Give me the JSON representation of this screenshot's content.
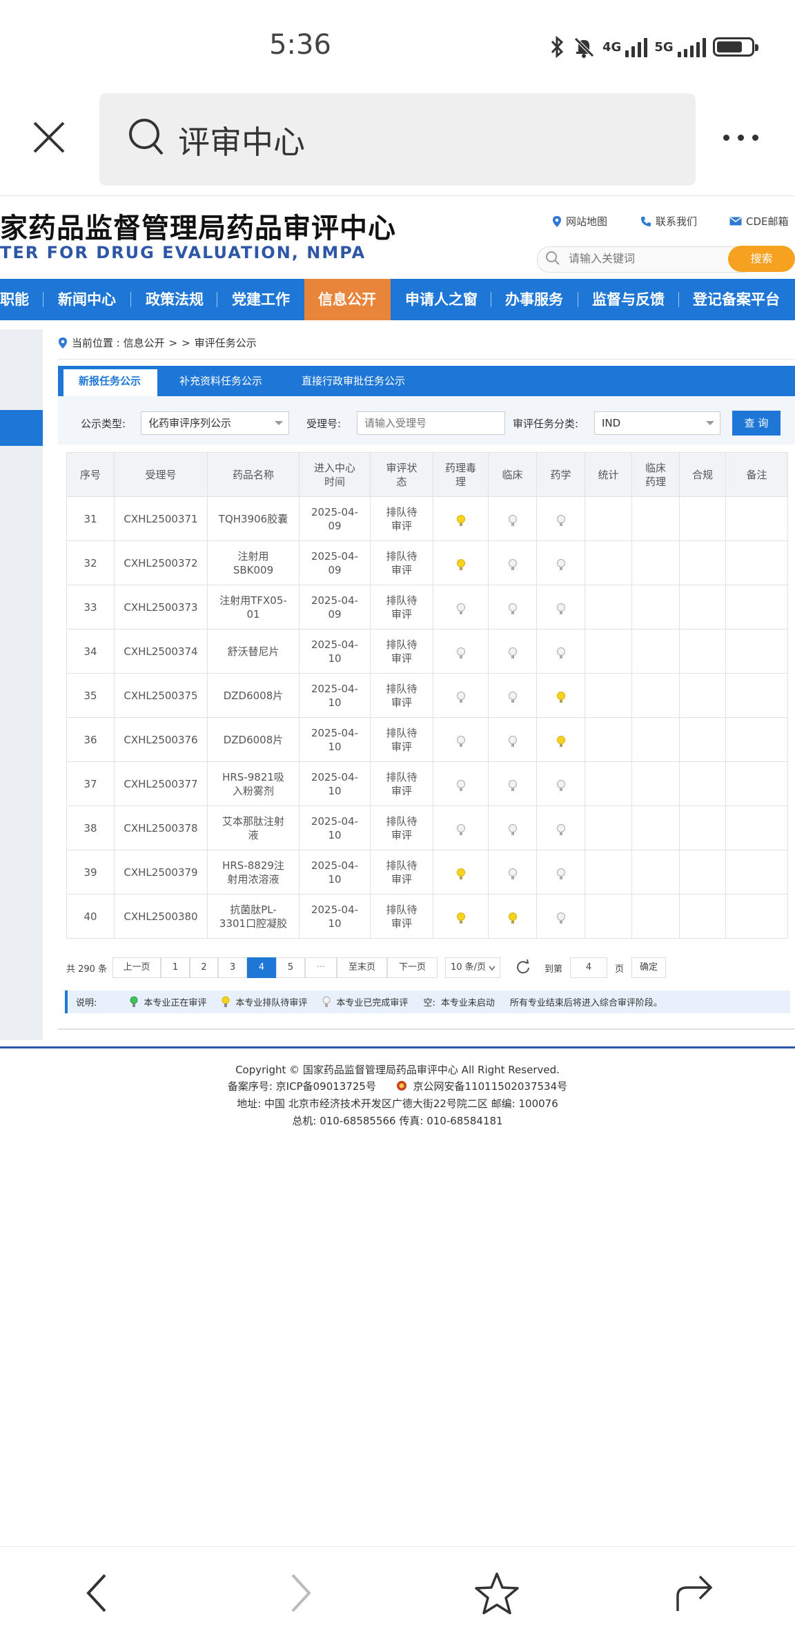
{
  "status_bar": {
    "time": "5:36",
    "net1": "4G",
    "net2": "5G"
  },
  "browser": {
    "search_text": "评审中心"
  },
  "site": {
    "title": "家药品监督管理局药品审评中心",
    "subtitle": "TER FOR DRUG EVALUATION, NMPA",
    "top_links": [
      "网站地图",
      "联系我们",
      "CDE邮箱"
    ],
    "search_placeholder": "请输入关键词",
    "search_button": "搜索"
  },
  "nav": {
    "items": [
      "职能",
      "新闻中心",
      "政策法规",
      "党建工作",
      "信息公开",
      "申请人之窗",
      "办事服务",
      "监督与反馈",
      "登记备案平台"
    ],
    "active": "信息公开"
  },
  "breadcrumb": {
    "label": "当前位置 : 信息公开",
    "sep1": ">",
    "sep2": ">",
    "current": "审评任务公示"
  },
  "tabs": [
    "新报任务公示",
    "补充资料任务公示",
    "直接行政审批任务公示"
  ],
  "filters": {
    "type_label": "公示类型:",
    "type_value": "化药审评序列公示",
    "accept_label": "受理号:",
    "accept_placeholder": "请输入受理号",
    "class_label": "审评任务分类:",
    "class_value": "IND",
    "query_button": "查 询"
  },
  "table": {
    "headers": [
      "序号",
      "受理号",
      "药品名称",
      "进入中心\n时间",
      "审评状\n态",
      "药理毒\n理",
      "临床",
      "药学",
      "统计",
      "临床\n药理",
      "合规",
      "备注"
    ],
    "rows": [
      {
        "no": "31",
        "id": "CXHL2500371",
        "name": "TQH3906胶囊",
        "date": "2025-04-\n09",
        "status": "排队待\n审评",
        "tox": "queue",
        "clin": "done",
        "pharm": "done"
      },
      {
        "no": "32",
        "id": "CXHL2500372",
        "name": "注射用\nSBK009",
        "date": "2025-04-\n09",
        "status": "排队待\n审评",
        "tox": "queue",
        "clin": "done",
        "pharm": "done"
      },
      {
        "no": "33",
        "id": "CXHL2500373",
        "name": "注射用TFX05-\n01",
        "date": "2025-04-\n09",
        "status": "排队待\n审评",
        "tox": "done",
        "clin": "done",
        "pharm": "done"
      },
      {
        "no": "34",
        "id": "CXHL2500374",
        "name": "舒沃替尼片",
        "date": "2025-04-\n10",
        "status": "排队待\n审评",
        "tox": "done",
        "clin": "done",
        "pharm": "done"
      },
      {
        "no": "35",
        "id": "CXHL2500375",
        "name": "DZD6008片",
        "date": "2025-04-\n10",
        "status": "排队待\n审评",
        "tox": "done",
        "clin": "done",
        "pharm": "queue"
      },
      {
        "no": "36",
        "id": "CXHL2500376",
        "name": "DZD6008片",
        "date": "2025-04-\n10",
        "status": "排队待\n审评",
        "tox": "done",
        "clin": "done",
        "pharm": "queue"
      },
      {
        "no": "37",
        "id": "CXHL2500377",
        "name": "HRS-9821吸\n入粉雾剂",
        "date": "2025-04-\n10",
        "status": "排队待\n审评",
        "tox": "done",
        "clin": "done",
        "pharm": "done"
      },
      {
        "no": "38",
        "id": "CXHL2500378",
        "name": "艾本那肽注射\n液",
        "date": "2025-04-\n10",
        "status": "排队待\n审评",
        "tox": "done",
        "clin": "done",
        "pharm": "done"
      },
      {
        "no": "39",
        "id": "CXHL2500379",
        "name": "HRS-8829注\n射用浓溶液",
        "date": "2025-04-\n10",
        "status": "排队待\n审评",
        "tox": "queue",
        "clin": "done",
        "pharm": "done"
      },
      {
        "no": "40",
        "id": "CXHL2500380",
        "name": "抗菌肽PL-\n3301口腔凝胶",
        "date": "2025-04-\n10",
        "status": "排队待\n审评",
        "tox": "queue",
        "clin": "queue",
        "pharm": "done"
      }
    ]
  },
  "pager": {
    "total": "共 290 条",
    "prev": "上一页",
    "pages": [
      "1",
      "2",
      "3",
      "4",
      "5"
    ],
    "current": "4",
    "ellipsis": "···",
    "last": "至末页",
    "next": "下一页",
    "per_page": "10 条/页",
    "goto_label": "到第",
    "goto_value": "4",
    "page_unit": "页",
    "confirm": "确定"
  },
  "legend": {
    "title": "说明:",
    "reviewing": "本专业正在审评",
    "queued": "本专业排队待审评",
    "completed": "本专业已完成审评",
    "empty_label": "空:",
    "empty_text": "本专业未启动",
    "note": "所有专业结束后将进入综合审评阶段。"
  },
  "footer": {
    "copyright": "Copyright © 国家药品监督管理局药品审评中心   All Right Reserved.",
    "icp": "备案序号:  京ICP备09013725号",
    "police": "京公网安备11011502037534号",
    "address": "地址:  中国 北京市经济技术开发区广德大街22号院二区       邮编:  100076",
    "phone": "总机:  010-68585566       传真:  010-68584181"
  },
  "colors": {
    "primary": "#1e77d6",
    "accent": "#e8853a",
    "search_btn": "#f7a120",
    "queued_bulb": "#f7d21f",
    "reviewing_bulb": "#3ec35a"
  }
}
